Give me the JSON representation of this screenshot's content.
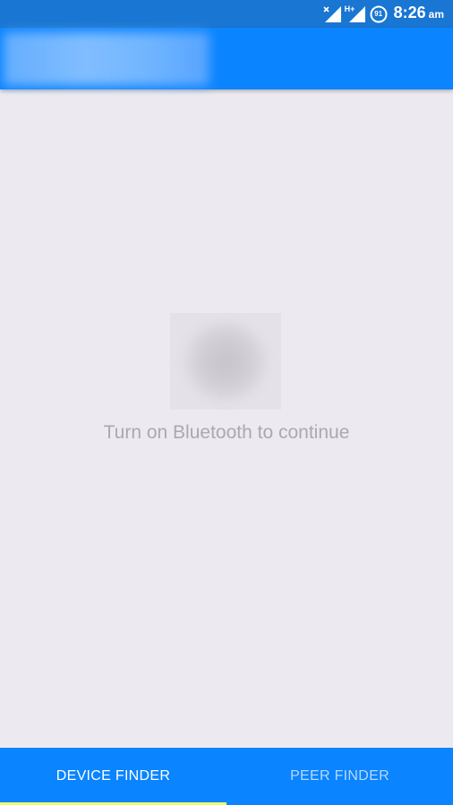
{
  "status_bar": {
    "time": "8:26",
    "ampm": "am",
    "network_type": "H+",
    "notification_count": "91"
  },
  "message": {
    "text": "Turn on Bluetooth to continue"
  },
  "tabs": [
    {
      "label": "DEVICE FINDER",
      "selected": true
    },
    {
      "label": "PEER FINDER",
      "selected": false
    }
  ],
  "colors": {
    "status_bar": "#1976D2",
    "app_bar": "#0A84FF",
    "background": "#ECEAF0",
    "tab_indicator": "#E8FF6A"
  }
}
